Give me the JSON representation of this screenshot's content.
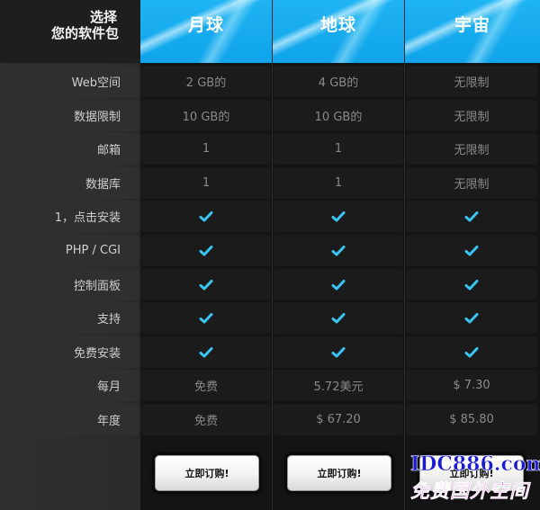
{
  "header": {
    "title_line1": "选择",
    "title_line2": "您的软件包",
    "plans": [
      "月球",
      "地球",
      "宇宙"
    ]
  },
  "rows": [
    {
      "label": "Web空间",
      "values": [
        "2 GB的",
        "4 GB的",
        "无限制"
      ]
    },
    {
      "label": "数据限制",
      "values": [
        "10 GB的",
        "10 GB的",
        "无限制"
      ]
    },
    {
      "label": "邮箱",
      "values": [
        "1",
        "1",
        "无限制"
      ]
    },
    {
      "label": "数据库",
      "values": [
        "1",
        "1",
        "无限制"
      ]
    },
    {
      "label": "1，点击安装",
      "values": [
        "check",
        "check",
        "check"
      ]
    },
    {
      "label": "PHP / CGI",
      "values": [
        "check",
        "check",
        "check"
      ]
    },
    {
      "label": "控制面板",
      "values": [
        "check",
        "check",
        "check"
      ]
    },
    {
      "label": "支持",
      "values": [
        "check",
        "check",
        "check"
      ]
    },
    {
      "label": "免费安装",
      "values": [
        "check",
        "check",
        "check"
      ]
    },
    {
      "label": "每月",
      "values": [
        "免费",
        "5.72美元",
        "$ 7.30"
      ]
    },
    {
      "label": "年度",
      "values": [
        "免费",
        "$ 67.20",
        "$ 85.80"
      ]
    }
  ],
  "buttons": {
    "order_label": "立即订购!"
  },
  "watermark": {
    "line1": "IDC886.com",
    "line2": "免费国外空间"
  },
  "colors": {
    "accent": "#1fb4f3",
    "check": "#39c6f4",
    "watermark_blue": "#1b1bd6",
    "watermark_pink": "#ff1fff"
  }
}
